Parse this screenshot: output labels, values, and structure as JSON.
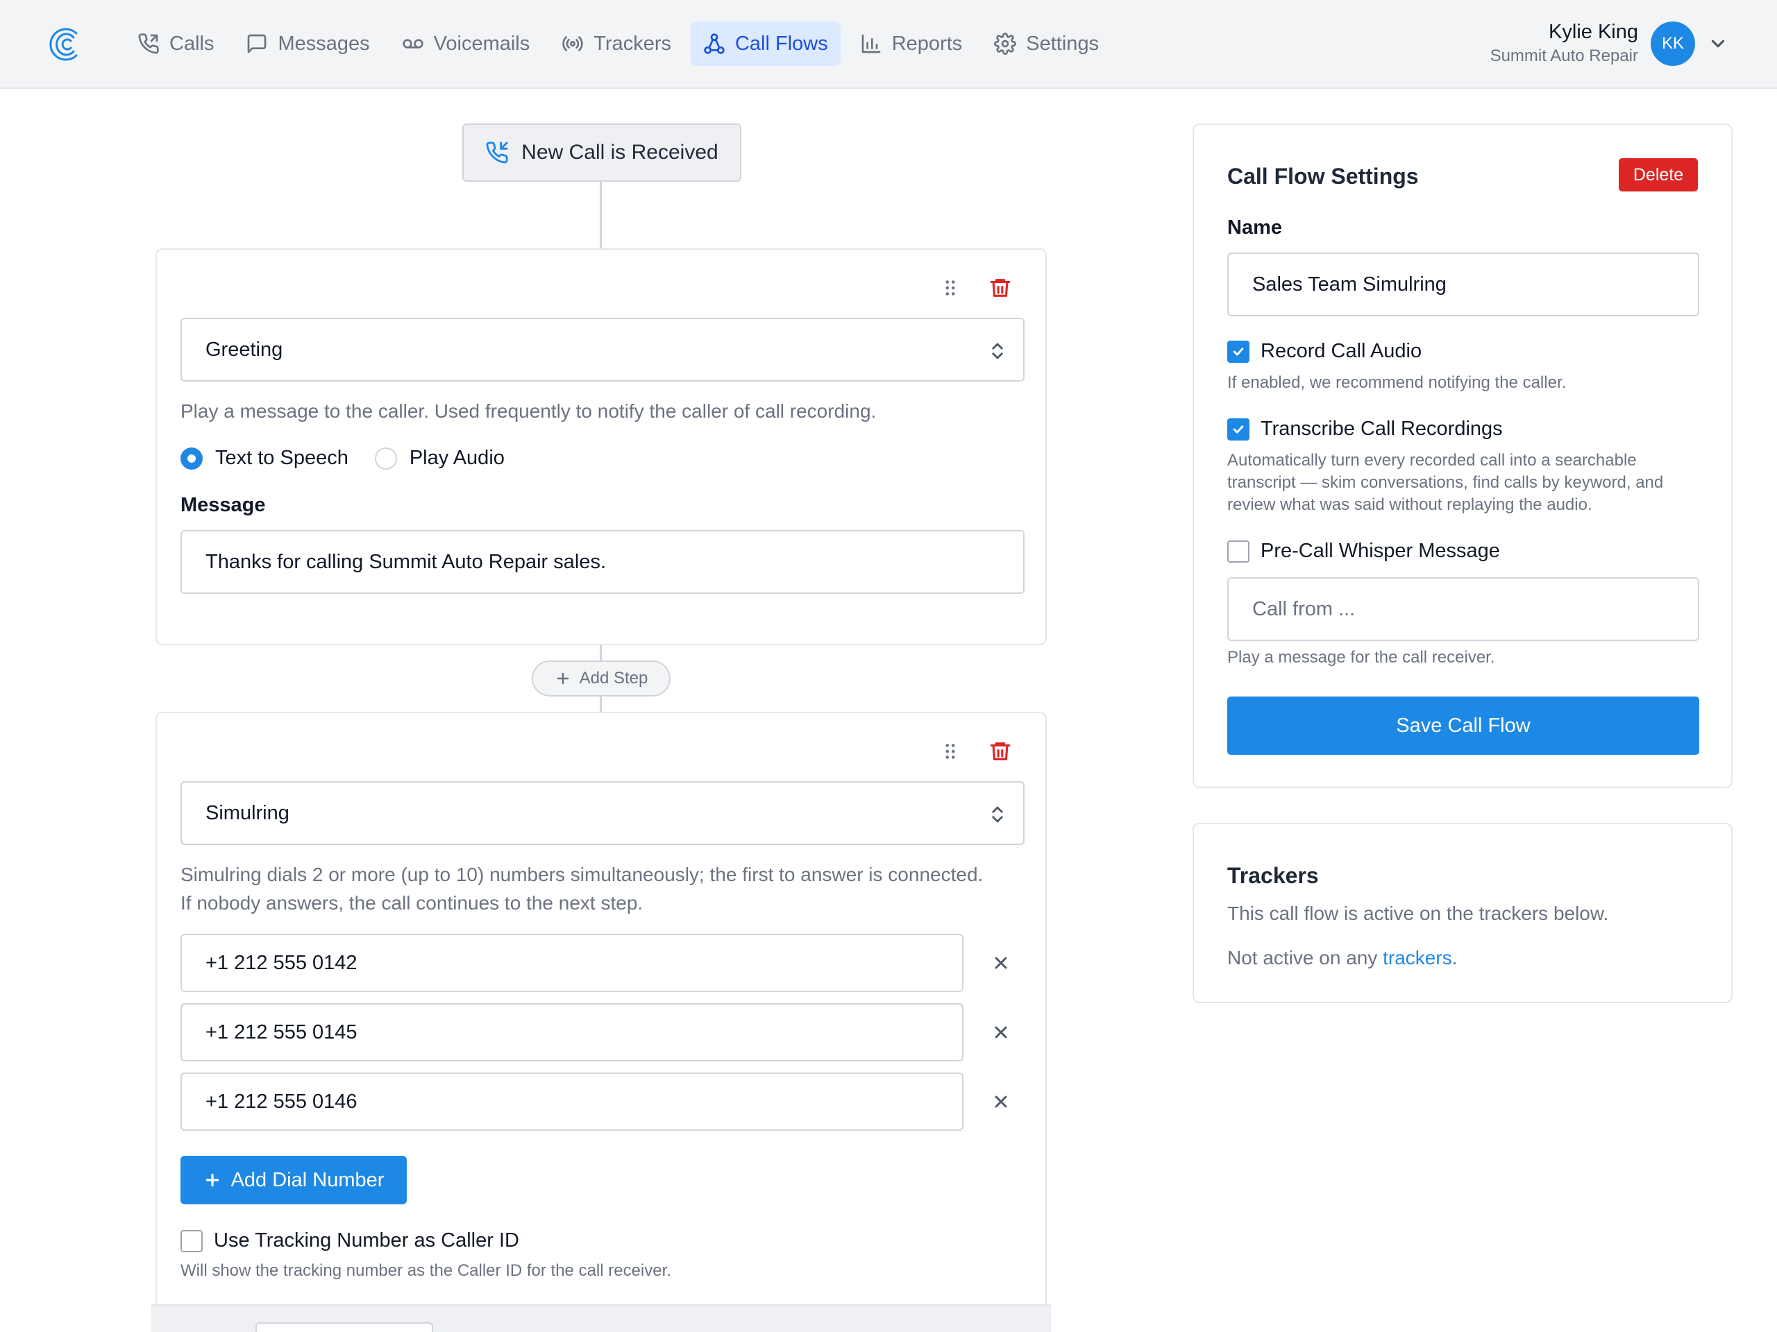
{
  "nav": {
    "items": [
      {
        "label": "Calls",
        "icon": "phone-icon"
      },
      {
        "label": "Messages",
        "icon": "message-icon"
      },
      {
        "label": "Voicemails",
        "icon": "voicemail-icon"
      },
      {
        "label": "Trackers",
        "icon": "broadcast-icon"
      },
      {
        "label": "Call Flows",
        "icon": "flow-icon",
        "active": true
      },
      {
        "label": "Reports",
        "icon": "bar-chart-icon"
      },
      {
        "label": "Settings",
        "icon": "gear-icon"
      }
    ]
  },
  "user": {
    "name": "Kylie King",
    "org": "Summit Auto Repair",
    "initials": "KK"
  },
  "flow": {
    "trigger_label": "New Call is Received",
    "add_step_label": "Add Step",
    "greeting": {
      "type": "Greeting",
      "description": "Play a message to the caller. Used frequently to notify the caller of call recording.",
      "radio_tts": "Text to Speech",
      "radio_audio": "Play Audio",
      "selected": "Text to Speech",
      "message_label": "Message",
      "message_value": "Thanks for calling Summit Auto Repair sales."
    },
    "simulring": {
      "type": "Simulring",
      "description_line1": "Simulring dials 2 or more (up to 10) numbers simultaneously; the first to answer is connected.",
      "description_line2": "If nobody answers, the call continues to the next step.",
      "numbers": [
        "+1 212 555 0142",
        "+1 212 555 0145",
        "+1 212 555 0146"
      ],
      "add_number_label": "Add Dial Number",
      "caller_id_label": "Use Tracking Number as Caller ID",
      "caller_id_checked": false,
      "caller_id_hint": "Will show the tracking number as the Caller ID for the call receiver."
    }
  },
  "settings": {
    "title": "Call Flow Settings",
    "delete_label": "Delete",
    "name_label": "Name",
    "name_value": "Sales Team Simulring",
    "record_label": "Record Call Audio",
    "record_checked": true,
    "record_hint": "If enabled, we recommend notifying the caller.",
    "transcribe_label": "Transcribe Call Recordings",
    "transcribe_checked": true,
    "transcribe_hint_1": "Automatically turn every recorded call into a searchable",
    "transcribe_hint_2": "transcript — skim conversations, find calls by keyword, and",
    "transcribe_hint_3": "review what was said without replaying the audio.",
    "whisper_label": "Pre-Call Whisper Message",
    "whisper_checked": false,
    "whisper_placeholder": "Call from ...",
    "whisper_hint": "Play a message for the call receiver.",
    "save_label": "Save Call Flow"
  },
  "trackers": {
    "title": "Trackers",
    "description": "This call flow is active on the trackers below.",
    "status_prefix": "Not active on any ",
    "status_link": "trackers",
    "status_suffix": "."
  },
  "colors": {
    "accent": "#1e88e5",
    "danger": "#dc2626",
    "active_nav_bg": "#dbeafe"
  }
}
